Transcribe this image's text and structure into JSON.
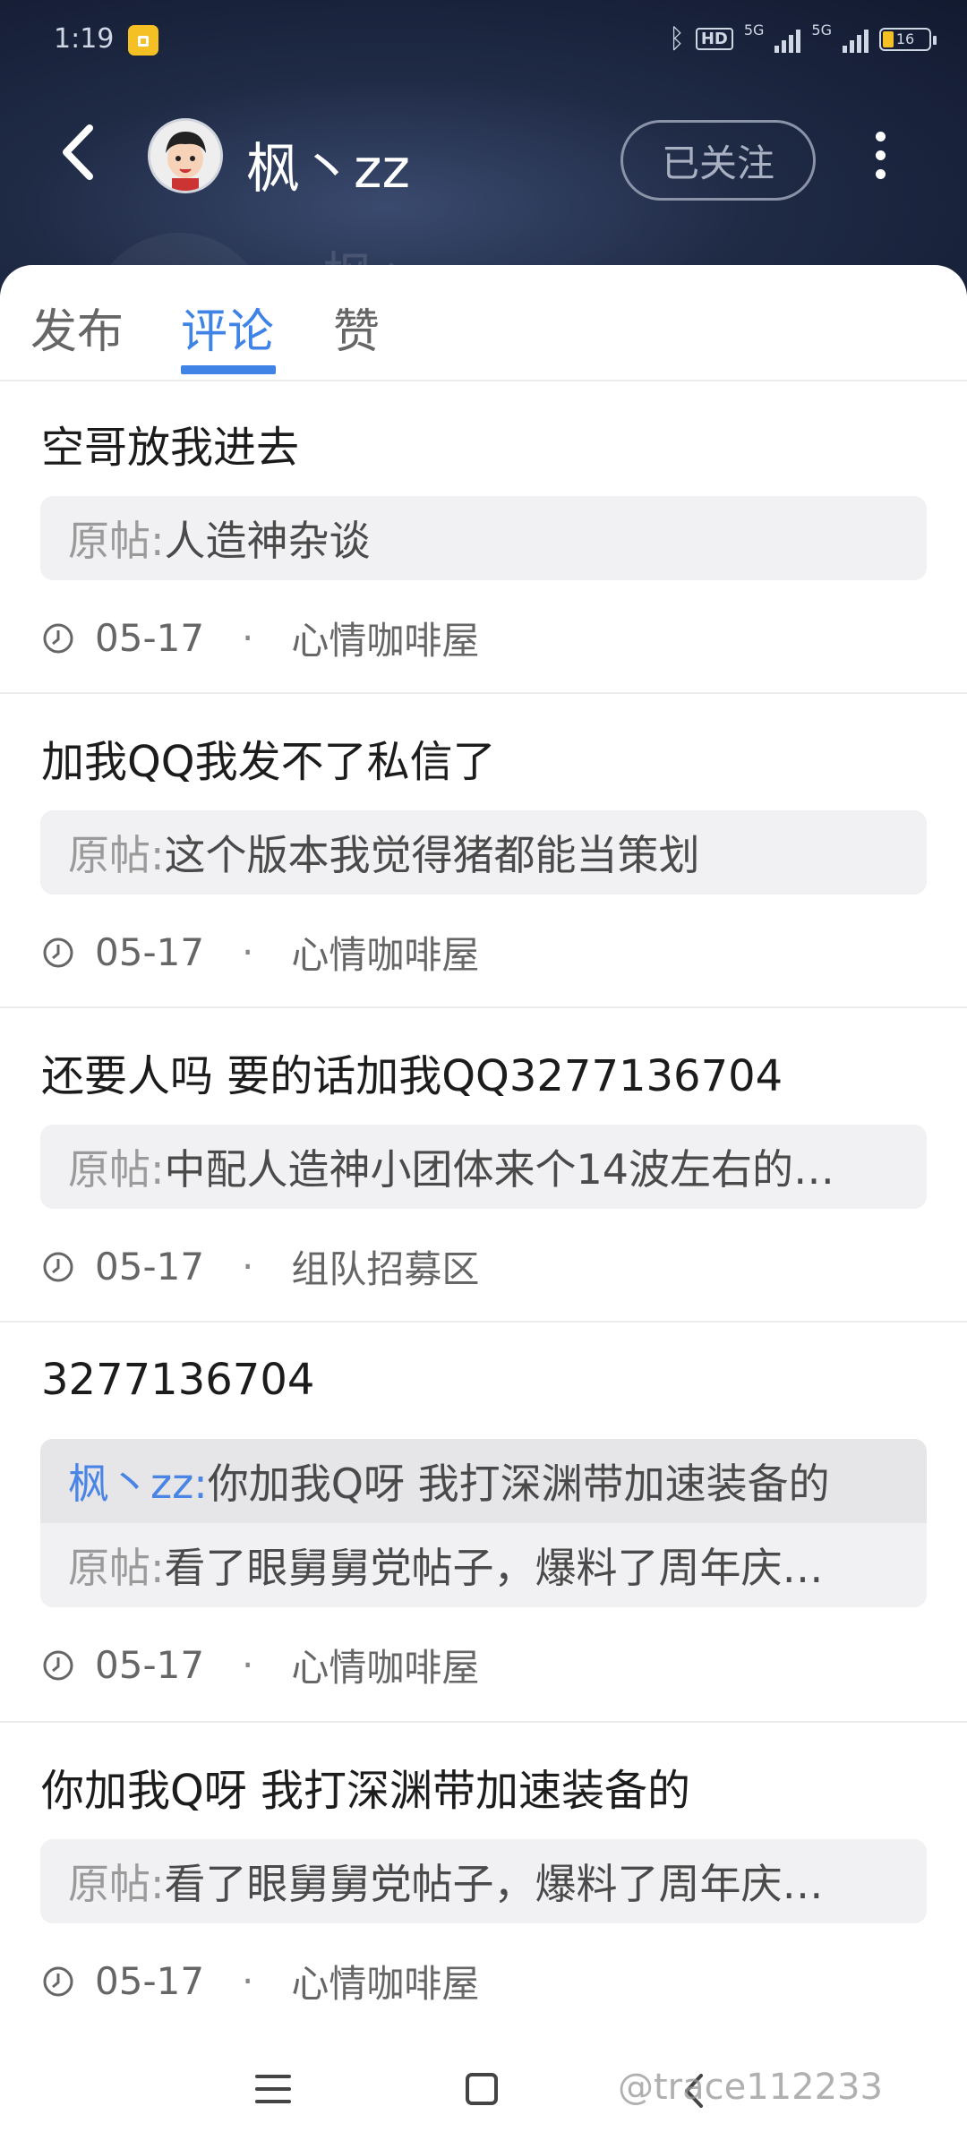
{
  "status_bar": {
    "time": "1:19",
    "hd_label": "HD",
    "signal1_label": "5G",
    "signal2_label": "5G",
    "battery": "16"
  },
  "header": {
    "username": "枫丶zz",
    "follow_label": "已关注",
    "background_colors": [
      "#1f2a45",
      "#3a4a6e"
    ]
  },
  "tabs": [
    {
      "label": "发布",
      "active": false
    },
    {
      "label": "评论",
      "active": true
    },
    {
      "label": "赞",
      "active": false
    }
  ],
  "accent_color": "#3f83e6",
  "comments": [
    {
      "text": "空哥放我进去",
      "post_label": "原帖:",
      "post_title": "人造神杂谈",
      "date": "05-17",
      "forum": "心情咖啡屋"
    },
    {
      "text": "加我QQ我发不了私信了",
      "post_label": "原帖:",
      "post_title": "这个版本我觉得猪都能当策划",
      "date": "05-17",
      "forum": "心情咖啡屋"
    },
    {
      "text": "还要人吗 要的话加我QQ3277136704",
      "post_label": "原帖:",
      "post_title": "中配人造神小团体来个14波左右的…",
      "date": "05-17",
      "forum": "组队招募区"
    },
    {
      "text": "3277136704",
      "reply_name": "枫丶zz:",
      "reply_text": "你加我Q呀 我打深渊带加速装备的",
      "post_label": "原帖:",
      "post_title": "看了眼舅舅党帖子，爆料了周年庆…",
      "date": "05-17",
      "forum": "心情咖啡屋"
    },
    {
      "text": "你加我Q呀 我打深渊带加速装备的",
      "post_label": "原帖:",
      "post_title": "看了眼舅舅党帖子，爆料了周年庆…",
      "date": "05-17",
      "forum": "心情咖啡屋"
    }
  ],
  "separator": "·",
  "watermark": "@trace112233",
  "icons": [
    "back-arrow-icon",
    "avatar",
    "more-vertical-icon",
    "clock-icon",
    "menu-icon",
    "home-icon",
    "back-icon"
  ]
}
